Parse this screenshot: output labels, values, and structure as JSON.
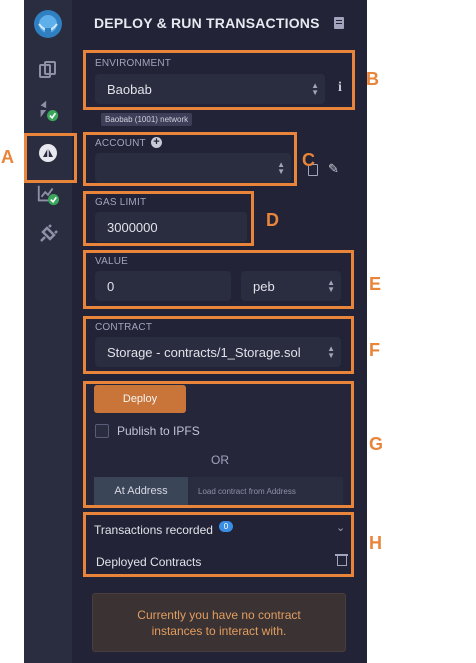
{
  "header": {
    "title": "DEPLOY & RUN TRANSACTIONS"
  },
  "environment": {
    "label": "ENVIRONMENT",
    "value": "Baobab",
    "network_badge": "Baobab (1001) network"
  },
  "account": {
    "label": "ACCOUNT",
    "value": ""
  },
  "gas": {
    "label": "GAS LIMIT",
    "value": "3000000"
  },
  "value_section": {
    "label": "VALUE",
    "amount": "0",
    "unit": "peb"
  },
  "contract": {
    "label": "CONTRACT",
    "value": "Storage - contracts/1_Storage.sol"
  },
  "deploy": {
    "deploy_label": "Deploy",
    "publish_label": "Publish to IPFS",
    "or_text": "OR",
    "at_address_label": "At Address",
    "address_placeholder": "Load contract from Address"
  },
  "transactions": {
    "recorded_label": "Transactions recorded",
    "recorded_count": "0",
    "deployed_label": "Deployed Contracts"
  },
  "notice": {
    "text_line1": "Currently you have no contract",
    "text_line2": "instances to interact with."
  },
  "annotations": {
    "A": "A",
    "B": "B",
    "C": "C",
    "D": "D",
    "E": "E",
    "F": "F",
    "G": "G",
    "H": "H"
  },
  "colors": {
    "accent": "#e8853b",
    "panel": "#222336",
    "iconbar": "#2a2c3f",
    "field": "#2a2c3f",
    "deploy_button": "#c97539",
    "notice_text": "#e29e5e"
  }
}
